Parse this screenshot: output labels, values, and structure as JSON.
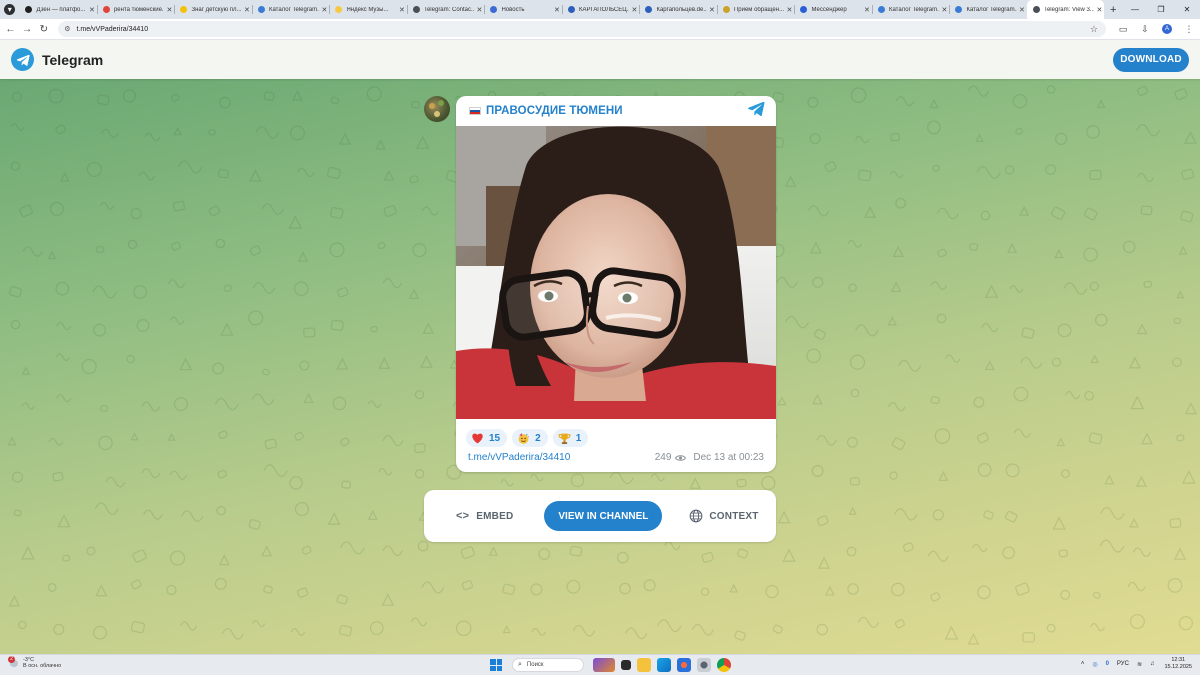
{
  "browser": {
    "tabs": [
      {
        "label": "Дзен — платфо...",
        "icon": "dzen-icon",
        "color": "#1f1f1f",
        "active": false
      },
      {
        "label": "рента тюменские...",
        "icon": "page-icon",
        "color": "#e0463c",
        "active": false
      },
      {
        "label": "Знаг детскую пл...",
        "icon": "video-icon",
        "color": "#f4c20d",
        "active": false
      },
      {
        "label": "Каталог Telegram...",
        "icon": "catalog-icon",
        "color": "#3b7bd5",
        "active": false
      },
      {
        "label": "Яндекс Музы...",
        "icon": "music-icon",
        "color": "#f6c944",
        "active": false
      },
      {
        "label": "Telegram: Contac...",
        "icon": "telegram-icon",
        "color": "#4a4f55",
        "active": false
      },
      {
        "label": "Новость",
        "icon": "news-icon",
        "color": "#3e6bd3",
        "active": false
      },
      {
        "label": "КАРГАПОЛЬСЕЦ...",
        "icon": "site-icon",
        "color": "#2d5fbd",
        "active": false
      },
      {
        "label": "Каргапольцев.de...",
        "icon": "site-icon",
        "color": "#2d5fbd",
        "active": false
      },
      {
        "label": "Прием обращен...",
        "icon": "gov-icon",
        "color": "#c9a227",
        "active": false
      },
      {
        "label": "Мессенджер",
        "icon": "messenger-icon",
        "color": "#2a5fd8",
        "active": false
      },
      {
        "label": "Каталог Telegram...",
        "icon": "catalog-icon",
        "color": "#3b7bd5",
        "active": false
      },
      {
        "label": "Каталог Telegram...",
        "icon": "catalog-icon",
        "color": "#3b7bd5",
        "active": false
      },
      {
        "label": "Telegram: View 3...",
        "icon": "telegram-icon",
        "color": "#4a4f55",
        "active": true
      }
    ],
    "new_tab": "+",
    "url": "t.me/vVPaderira/34410"
  },
  "header": {
    "brand": "Telegram",
    "download_label": "DOWNLOAD"
  },
  "post": {
    "channel_name": "ПРАВОСУДИЕ ТЮМЕНИ",
    "reactions": [
      {
        "icon": "heart-icon",
        "count": "15"
      },
      {
        "icon": "party-face-icon",
        "count": "2"
      },
      {
        "icon": "trophy-icon",
        "count": "1"
      }
    ],
    "link": "t.me/vVPaderira/34410",
    "views": "249",
    "date": "Dec 13 at 00:23"
  },
  "actions": {
    "embed_label": "EMBED",
    "view_label": "VIEW IN CHANNEL",
    "context_label": "CONTEXT"
  },
  "taskbar": {
    "weather_temp": "-3°C",
    "weather_desc": "В осн. облачно",
    "weather_badge": "2",
    "search_placeholder": "Поиск",
    "tray_count": "0",
    "language": "РУС",
    "time": "12:31",
    "date": "15.12.2025"
  },
  "colors": {
    "accent": "#2481cc",
    "wallpaper_top": "#6aa873",
    "wallpaper_bottom": "#e1dc93"
  }
}
